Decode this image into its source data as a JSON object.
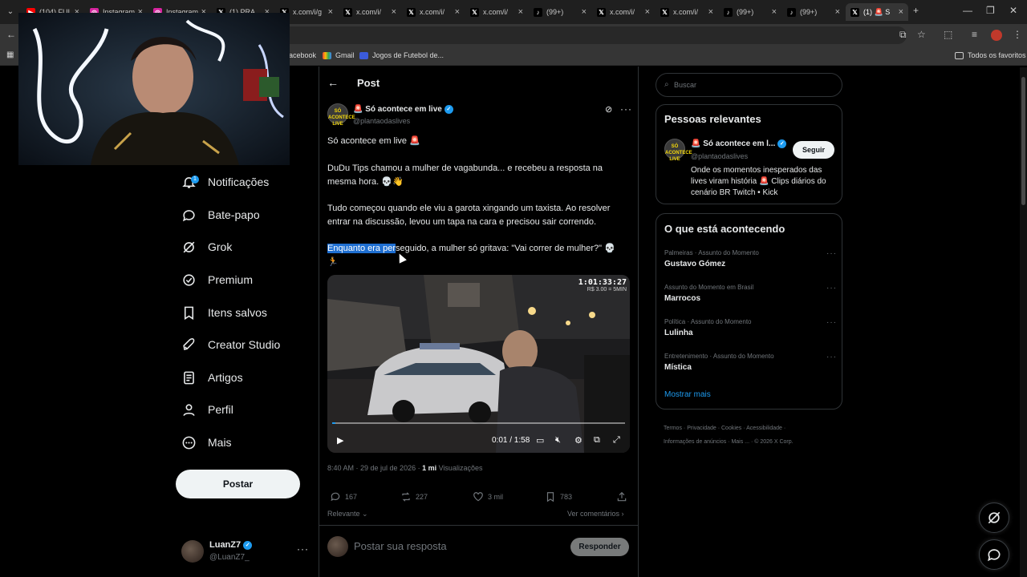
{
  "browser": {
    "tabs": [
      {
        "label": "(104) FUI",
        "icon": "youtube-icon",
        "color": "#ff0000"
      },
      {
        "label": "Instagram",
        "icon": "instagram-icon",
        "color": "#d6249f"
      },
      {
        "label": "Instagram",
        "icon": "instagram-icon",
        "color": "#d6249f"
      },
      {
        "label": "(1) PRA...",
        "icon": "x-icon",
        "color": "#000000"
      },
      {
        "label": "x.com/i/g",
        "icon": "x-icon",
        "color": "#000000"
      },
      {
        "label": "x.com/i/",
        "icon": "x-icon",
        "color": "#000000"
      },
      {
        "label": "x.com/i/",
        "icon": "x-icon",
        "color": "#000000"
      },
      {
        "label": "x.com/i/",
        "icon": "x-icon",
        "color": "#000000"
      },
      {
        "label": "(99+)",
        "icon": "tiktok-icon",
        "color": "#000000"
      },
      {
        "label": "x.com/i/",
        "icon": "x-icon",
        "color": "#000000"
      },
      {
        "label": "x.com/i/",
        "icon": "x-icon",
        "color": "#000000"
      },
      {
        "label": "(99+)",
        "icon": "tiktok-icon",
        "color": "#000000"
      },
      {
        "label": "(99+)",
        "icon": "tiktok-icon",
        "color": "#000000"
      },
      {
        "label": "(1) 🚨 S",
        "icon": "x-icon",
        "color": "#000000"
      }
    ],
    "bookmarks": [
      {
        "label": "acebook"
      },
      {
        "label": "Gmail"
      },
      {
        "label": "Jogos de Futebol de..."
      }
    ],
    "bookmarks_right": "Todos os favoritos"
  },
  "nav": {
    "notification_count": "1",
    "items": [
      {
        "label": "Notificações",
        "icon": "bell-icon"
      },
      {
        "label": "Bate-papo",
        "icon": "chat-icon"
      },
      {
        "label": "Grok",
        "icon": "grok-icon"
      },
      {
        "label": "Premium",
        "icon": "premium-icon"
      },
      {
        "label": "Itens salvos",
        "icon": "bookmark-icon"
      },
      {
        "label": "Creator Studio",
        "icon": "rocket-icon"
      },
      {
        "label": "Artigos",
        "icon": "article-icon"
      },
      {
        "label": "Perfil",
        "icon": "person-icon"
      },
      {
        "label": "Mais",
        "icon": "more-circle-icon"
      }
    ],
    "post_button": "Postar",
    "account": {
      "name": "LuanZ7",
      "handle": "@LuanZ7_"
    }
  },
  "post": {
    "heading": "Post",
    "author": {
      "name": "🚨 Só acontece em live",
      "handle": "@plantaodaslives",
      "avatar_text": "SÓ ACONTECE LIVE"
    },
    "lines": {
      "p1": "Só acontece em live 🚨",
      "p2": "DuDu Tips chamou a mulher de vagabunda... e recebeu a resposta na mesma hora. 💀👋",
      "p3": "Tudo começou quando ele viu a garota xingando um taxista. Ao resolver entrar na discussão, levou um tapa na cara e precisou sair correndo.",
      "p4_highlight": "Enquanto era per",
      "p4_rest": "seguido, a mulher só gritava: \"Vai correr de mulher?\" 💀🏃"
    },
    "video": {
      "timecode": "1:01:33:27",
      "subcode": "R$ 3.00 = 5MIN",
      "time": "0:01 / 1:58",
      "progress": 0.01
    },
    "meta": {
      "time": "8:40 AM · 29 de jul de 2026 · ",
      "views": "1 mi",
      "views_label": " Visualizações"
    },
    "actions": {
      "replies": "167",
      "reposts": "227",
      "likes": "3 mil",
      "bookmarks": "783"
    },
    "relevance": "Relevante",
    "see_comments": "Ver comentários",
    "reply_placeholder": "Postar sua resposta",
    "reply_button": "Responder"
  },
  "sidebar": {
    "search_placeholder": "Buscar",
    "relevant_title": "Pessoas relevantes",
    "relevant_person": {
      "name": "🚨 Só acontece em l...",
      "handle": "@plantaodaslives",
      "bio": "Onde os momentos inesperados das lives viram história 🚨 Clips diários do cenário BR Twitch • Kick",
      "follow": "Seguir",
      "avatar_text": "SÓ ACONTECE LIVE"
    },
    "trends_title": "O que está acontecendo",
    "trends": [
      {
        "context": "Palmeiras · Assunto do Momento",
        "name": "Gustavo Gómez"
      },
      {
        "context": "Assunto do Momento em Brasil",
        "name": "Marrocos"
      },
      {
        "context": "Política · Assunto do Momento",
        "name": "Lulinha"
      },
      {
        "context": "Entretenimento · Assunto do Momento",
        "name": "Mística"
      }
    ],
    "show_more": "Mostrar mais",
    "footer": [
      "Termos",
      "Privacidade",
      "Cookies",
      "Acessibilidade",
      "Informações de anúncios",
      "Mais ...",
      "© 2026 X Corp."
    ]
  }
}
